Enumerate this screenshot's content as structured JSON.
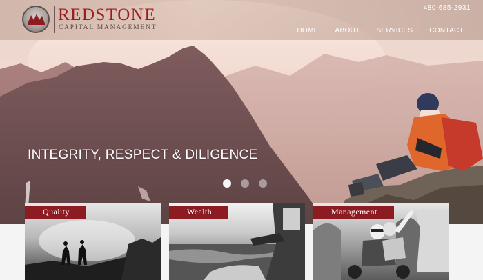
{
  "brand": {
    "name": "REDSTONE",
    "subtitle": "CAPITAL MANAGEMENT",
    "phone": "480-685-2931",
    "accent_color": "#8d1b22"
  },
  "nav": {
    "items": [
      {
        "label": "HOME"
      },
      {
        "label": "ABOUT"
      },
      {
        "label": "SERVICES"
      },
      {
        "label": "CONTACT"
      }
    ]
  },
  "hero": {
    "tagline": "INTEGRITY, RESPECT & DILIGENCE",
    "slide_count": 3,
    "active_slide": 1
  },
  "cards": [
    {
      "label": "Quality",
      "icon": "hikers-photo"
    },
    {
      "label": "Wealth",
      "icon": "boat-water-photo"
    },
    {
      "label": "Management",
      "icon": "scooter-couple-photo"
    }
  ]
}
